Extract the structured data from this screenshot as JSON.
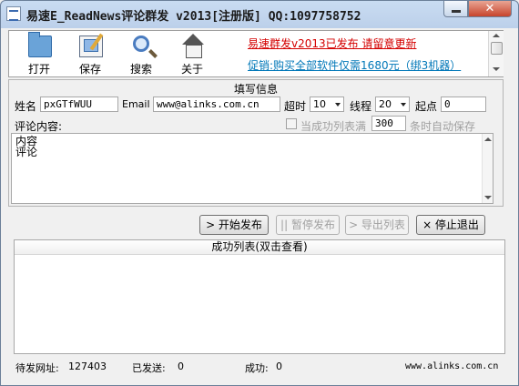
{
  "window": {
    "title": "易速E_ReadNews评论群发 v2013[注册版] QQ:1097758752",
    "close_glyph": "✕"
  },
  "toolbar": {
    "items": [
      {
        "label": "打开",
        "icon": "folder-icon"
      },
      {
        "label": "保存",
        "icon": "save-icon"
      },
      {
        "label": "搜索",
        "icon": "search-icon"
      },
      {
        "label": "关于",
        "icon": "home-icon"
      }
    ],
    "promo_line1": "易速群发v2013已发布 请留意更新",
    "promo_line2": "促销:购买全部软件仅需1680元（绑3机器）",
    "promo_color1": "#d40000",
    "promo_color2": "#0077b8"
  },
  "form": {
    "group_title": "填写信息",
    "name_label": "姓名",
    "name_value": "pxGTfWUU",
    "email_label": "Email",
    "email_value": "www@alinks.com.cn",
    "timeout_label": "超时",
    "timeout_value": "10",
    "threads_label": "线程",
    "threads_value": "20",
    "start_label": "起点",
    "start_value": "0",
    "content_label": "评论内容:",
    "autosave_prefix": "当成功列表满",
    "autosave_value": "300",
    "autosave_suffix": "条时自动保存",
    "content_lines": [
      "内容",
      "评论"
    ]
  },
  "actions": {
    "start": "> 开始发布",
    "pause": "|| 暂停发布",
    "export": "> 导出列表",
    "stop": "× 停止退出"
  },
  "success_list": {
    "header": "成功列表(双击查看)"
  },
  "status": {
    "pending_label": "待发网址:",
    "pending_value": "127403",
    "sent_label": "已发送:",
    "sent_value": "0",
    "success_label": "成功:",
    "success_value": "0",
    "site": "www.alinks.com.cn"
  }
}
